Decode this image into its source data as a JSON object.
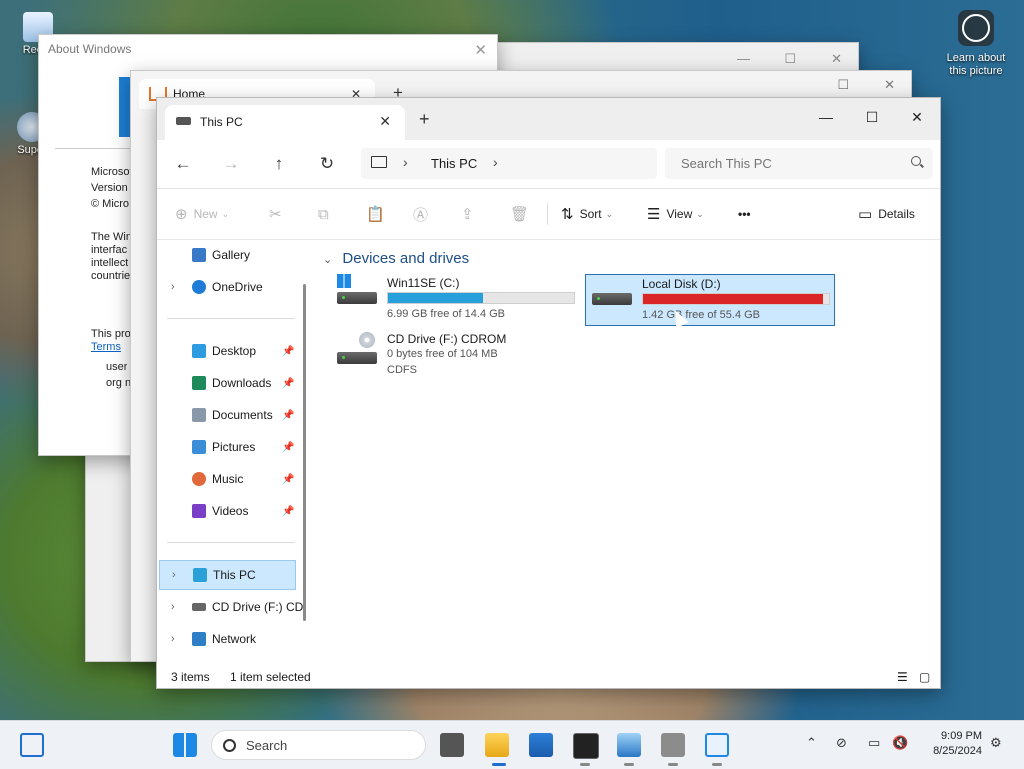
{
  "desktop": {
    "icons": [
      {
        "label": "Recyc"
      },
      {
        "label": "Super"
      }
    ],
    "learn_label": "Learn about this picture"
  },
  "about_window": {
    "title": "About Windows",
    "lines": [
      "Microsof",
      "Version",
      "© Micro",
      "The Win",
      "interfac",
      "intellect",
      "countrie",
      "This prod",
      "Terms",
      "user",
      "org n"
    ]
  },
  "home_window": {
    "tab_label": "Home"
  },
  "explorer": {
    "tab_title": "This PC",
    "address": {
      "crumb": "This PC"
    },
    "search": {
      "placeholder": "Search This PC"
    },
    "commands": {
      "new_label": "New",
      "sort_label": "Sort",
      "view_label": "View",
      "more_label": "•••",
      "details_label": "Details"
    },
    "sidebar": {
      "items": [
        {
          "label": "Gallery"
        },
        {
          "label": "OneDrive"
        },
        {
          "label": "Desktop"
        },
        {
          "label": "Downloads"
        },
        {
          "label": "Documents"
        },
        {
          "label": "Pictures"
        },
        {
          "label": "Music"
        },
        {
          "label": "Videos"
        },
        {
          "label": "This PC"
        },
        {
          "label": "CD Drive (F:) CD"
        },
        {
          "label": "Network"
        }
      ]
    },
    "section_title": "Devices and drives",
    "drives": [
      {
        "name": "Win11SE (C:)",
        "free_text": "6.99 GB free of 14.4 GB",
        "used_fraction": 0.51,
        "bar_color": "#26a0da"
      },
      {
        "name": "Local Disk (D:)",
        "free_text": "1.42 GB free of 55.4 GB",
        "used_fraction": 0.97,
        "bar_color": "#da2626"
      },
      {
        "name": "CD Drive (F:) CDROM",
        "free_text": "0 bytes free of 104 MB",
        "fs_text": "CDFS"
      }
    ],
    "status": {
      "items_count": "3 items",
      "selected": "1 item selected"
    }
  },
  "taskbar": {
    "search_label": "Search",
    "time": "9:09 PM",
    "date": "8/25/2024"
  },
  "colors": {
    "accent": "#0067c0",
    "selection": "#cce8ff"
  }
}
